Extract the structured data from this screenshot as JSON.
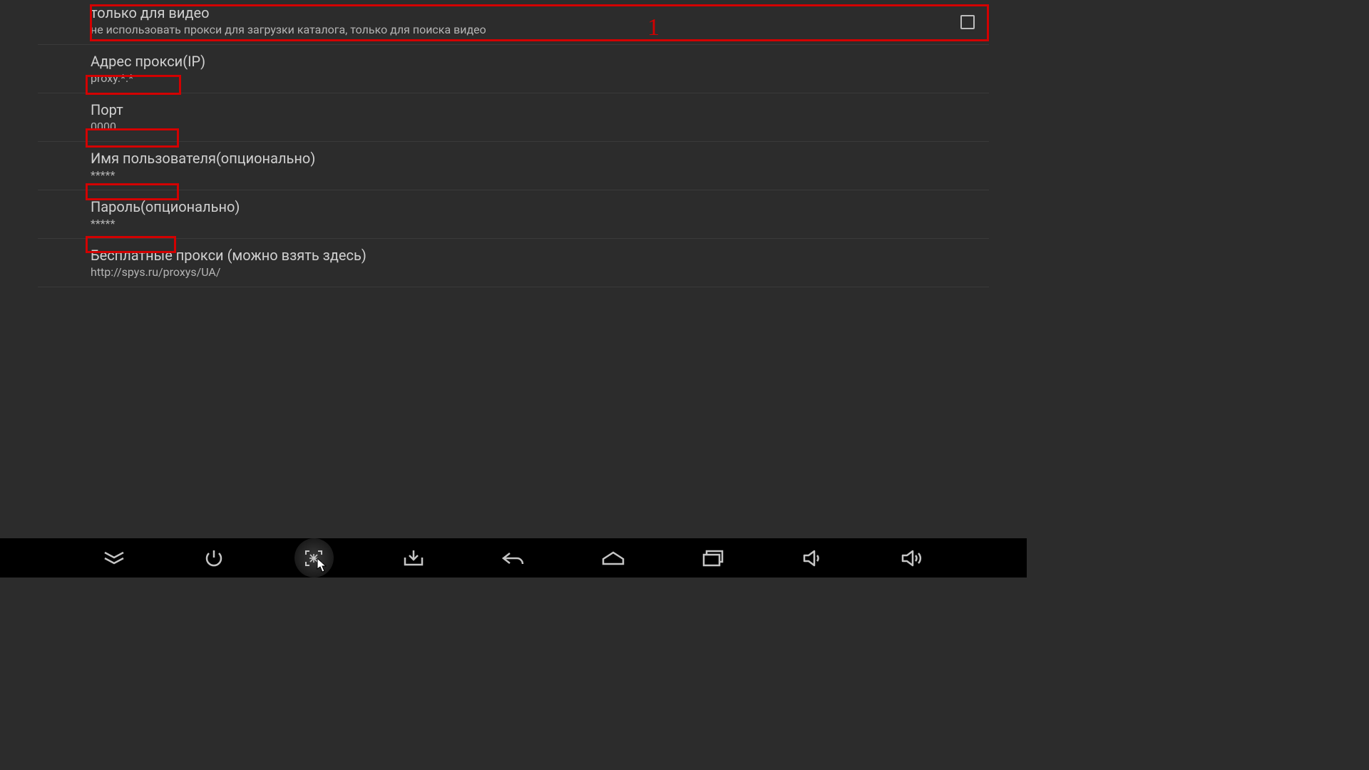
{
  "rows": {
    "video_only": {
      "title": "только для видео",
      "sub": "не использовать прокси для загрузки каталога, только для поиска видео"
    },
    "proxy_addr": {
      "title": "Адрес прокси(IP)",
      "sub": "proxy.*.*"
    },
    "port": {
      "title": "Порт",
      "sub": "0000"
    },
    "username": {
      "title": "Имя пользователя(опционально)",
      "sub": "*****"
    },
    "password": {
      "title": "Пароль(опционально)",
      "sub": "*****"
    },
    "free_proxy": {
      "title": "Бесплатные прокси (можно взять здесь)",
      "sub": "http://spys.ru/proxys/UA/"
    }
  },
  "annot": {
    "label1": "1"
  }
}
